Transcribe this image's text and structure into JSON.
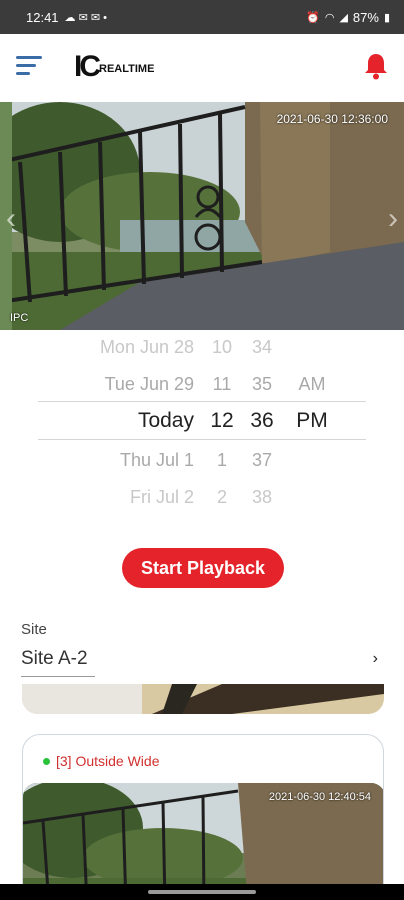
{
  "status": {
    "time": "12:41",
    "battery": "87%"
  },
  "header": {
    "logo_ic": "IC",
    "logo_text": "REALTIME"
  },
  "live": {
    "timestamp": "2021-06-30 12:36:00",
    "channel_label": "IPC"
  },
  "picker": {
    "rows": [
      {
        "day": "Mon Jun 28",
        "hour": "10",
        "minute": "34",
        "ampm": ""
      },
      {
        "day": "Tue Jun 29",
        "hour": "11",
        "minute": "35",
        "ampm": "AM"
      },
      {
        "day": "Today",
        "hour": "12",
        "minute": "36",
        "ampm": "PM"
      },
      {
        "day": "Thu Jul 1",
        "hour": "1",
        "minute": "37",
        "ampm": ""
      },
      {
        "day": "Fri Jul 2",
        "hour": "2",
        "minute": "38",
        "ampm": ""
      }
    ]
  },
  "start_playback": "Start Playback",
  "site": {
    "label": "Site",
    "value": "Site A-2"
  },
  "camera_card": {
    "name": "[3] Outside Wide",
    "timestamp": "2021-06-30 12:40:54"
  },
  "colors": {
    "accent": "#e4242a",
    "menu": "#3a6da8",
    "online": "#29c23a"
  }
}
